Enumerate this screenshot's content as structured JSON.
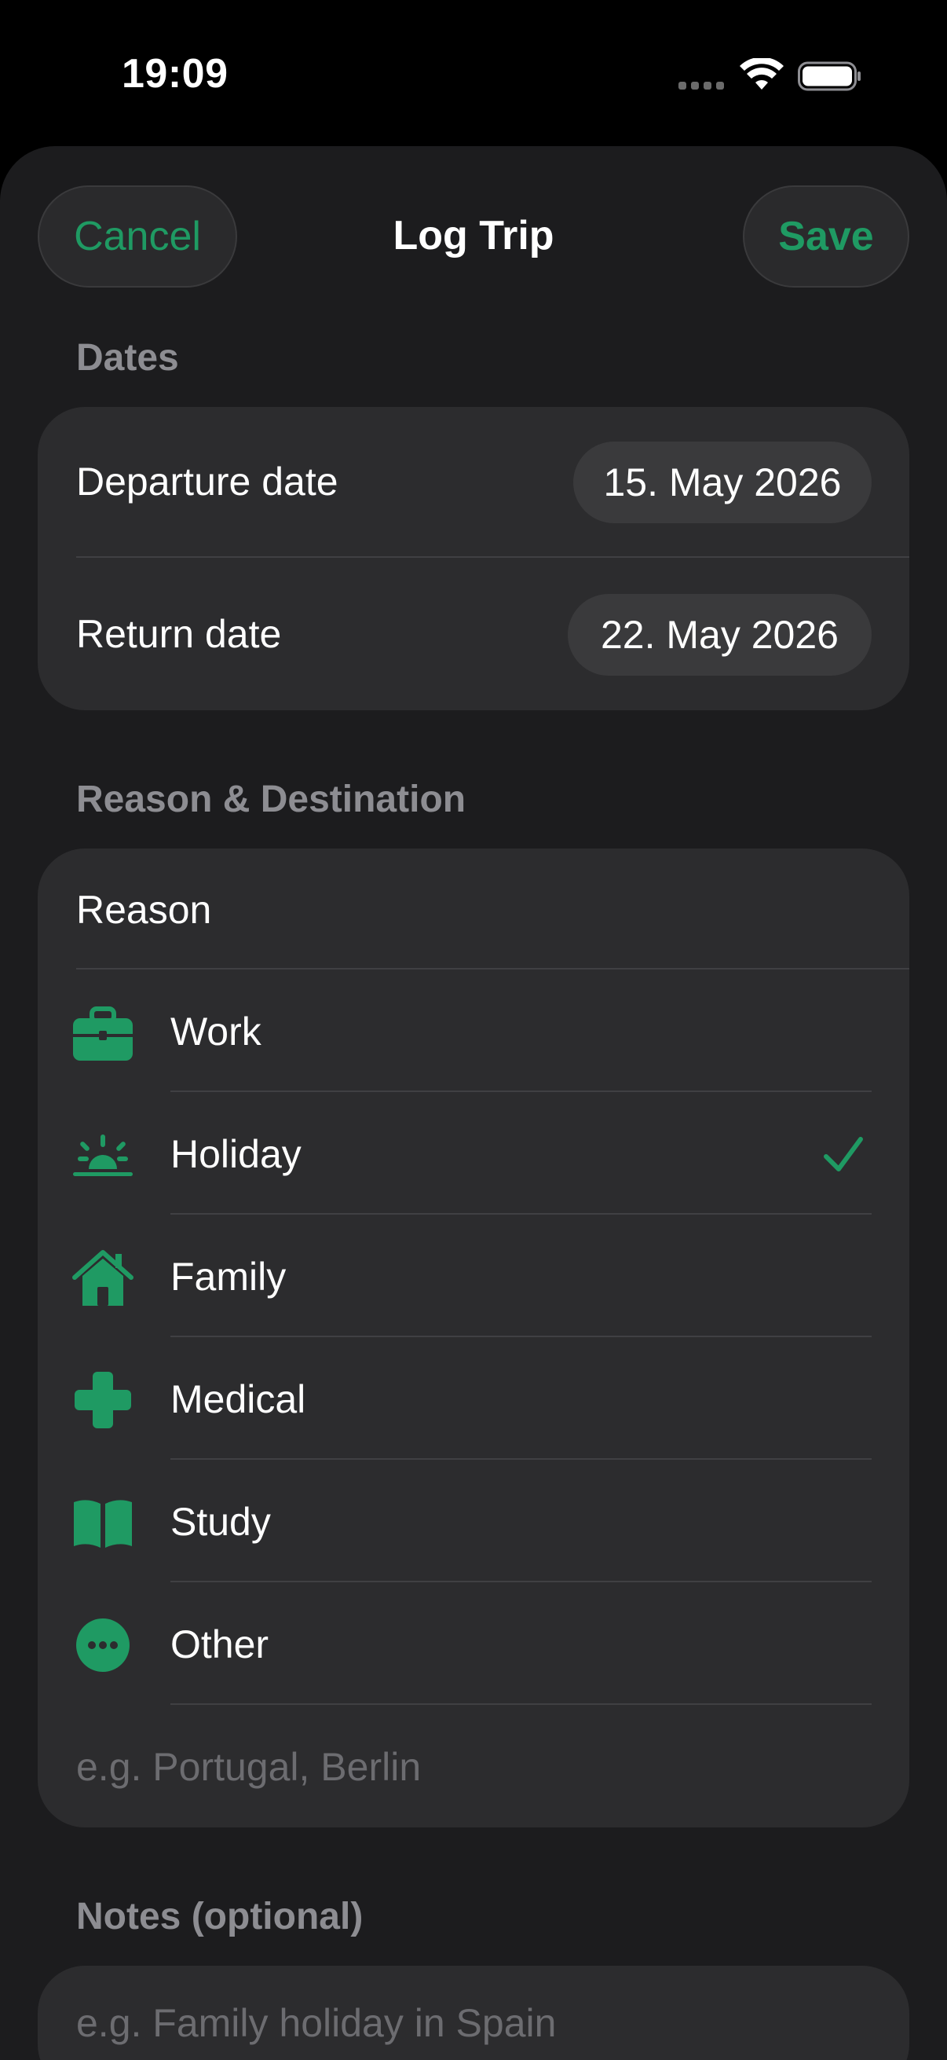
{
  "status_bar": {
    "time": "19:09"
  },
  "nav": {
    "cancel_label": "Cancel",
    "title": "Log Trip",
    "save_label": "Save"
  },
  "dates": {
    "header": "Dates",
    "departure_label": "Departure date",
    "departure_value": "15. May 2026",
    "return_label": "Return date",
    "return_value": "22. May 2026"
  },
  "reason_destination": {
    "header": "Reason & Destination",
    "reason_label": "Reason",
    "options": [
      {
        "label": "Work",
        "icon": "briefcase-icon",
        "selected": false
      },
      {
        "label": "Holiday",
        "icon": "sunrise-icon",
        "selected": true
      },
      {
        "label": "Family",
        "icon": "house-icon",
        "selected": false
      },
      {
        "label": "Medical",
        "icon": "cross-icon",
        "selected": false
      },
      {
        "label": "Study",
        "icon": "book-icon",
        "selected": false
      },
      {
        "label": "Other",
        "icon": "ellipsis-circle-icon",
        "selected": false
      }
    ],
    "destination_placeholder": "e.g. Portugal, Berlin"
  },
  "notes": {
    "header": "Notes (optional)",
    "placeholder": "e.g. Family holiday in Spain"
  },
  "colors": {
    "accent": "#1f9a63",
    "background": "#1c1c1e",
    "card": "#2c2c2e",
    "secondary_text": "#8d8d92"
  }
}
